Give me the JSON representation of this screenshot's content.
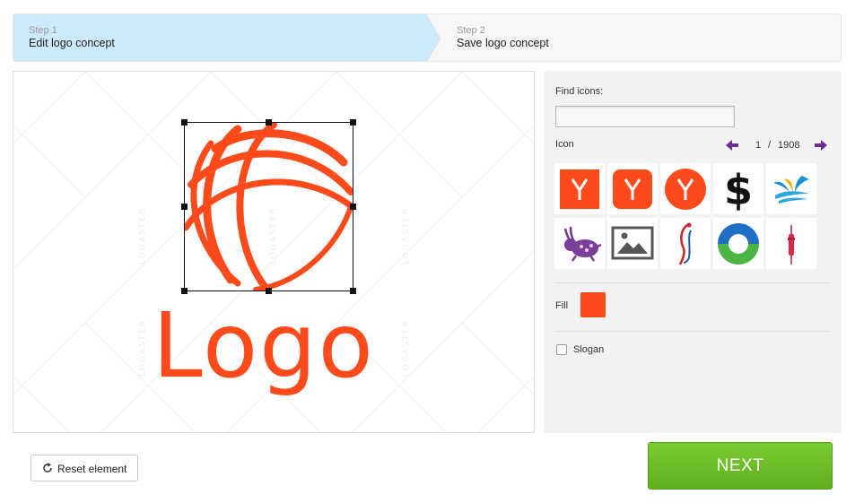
{
  "stepper": {
    "step1": {
      "number": "Step 1",
      "title": "Edit logo concept",
      "active": true
    },
    "step2": {
      "number": "Step 2",
      "title": "Save logo concept",
      "active": false
    }
  },
  "canvas": {
    "logo_text": "Logo",
    "logo_icon": "globe-stripes-icon",
    "watermark": "LOGASTER"
  },
  "panel": {
    "find_icons_label": "Find icons:",
    "search_value": "",
    "icon_label": "Icon",
    "pager": {
      "current": "1",
      "separator": "/",
      "total": "1908"
    },
    "icons": [
      "y-square-icon",
      "y-rounded-icon",
      "y-circle-icon",
      "dollar-icon",
      "bird-waves-icon",
      "rabbit-icon",
      "image-placeholder-icon",
      "figure-swirl-icon",
      "ring-icon",
      "pen-needle-icon"
    ],
    "fill_label": "Fill",
    "slogan_label": "Slogan",
    "slogan_checked": false
  },
  "actions": {
    "reset_label": "Reset element",
    "next_label": "NEXT"
  },
  "colors": {
    "accent": "#fc4a1a",
    "step_active": "#cdeafb",
    "next_green": "#6cbc29"
  }
}
